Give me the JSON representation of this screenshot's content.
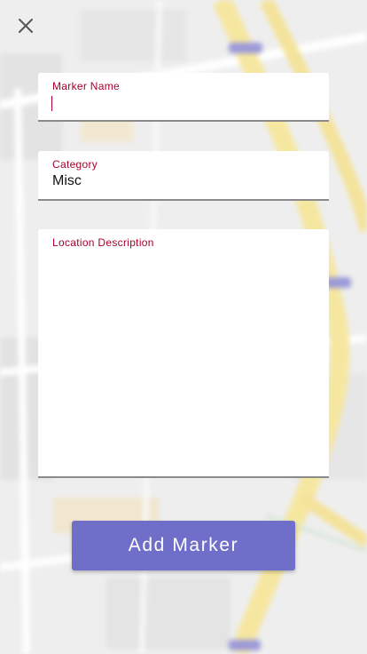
{
  "close": {
    "icon": "close-icon"
  },
  "form": {
    "marker_name": {
      "label": "Marker Name",
      "value": ""
    },
    "category": {
      "label": "Category",
      "value": "Misc"
    },
    "location_description": {
      "label": "Location Description",
      "value": ""
    }
  },
  "submit": {
    "label": "Add Marker"
  },
  "colors": {
    "accent": "#a8002a",
    "button": "#6f6ec8",
    "field_bg": "#ffffff",
    "underline": "#8a8a8a"
  }
}
